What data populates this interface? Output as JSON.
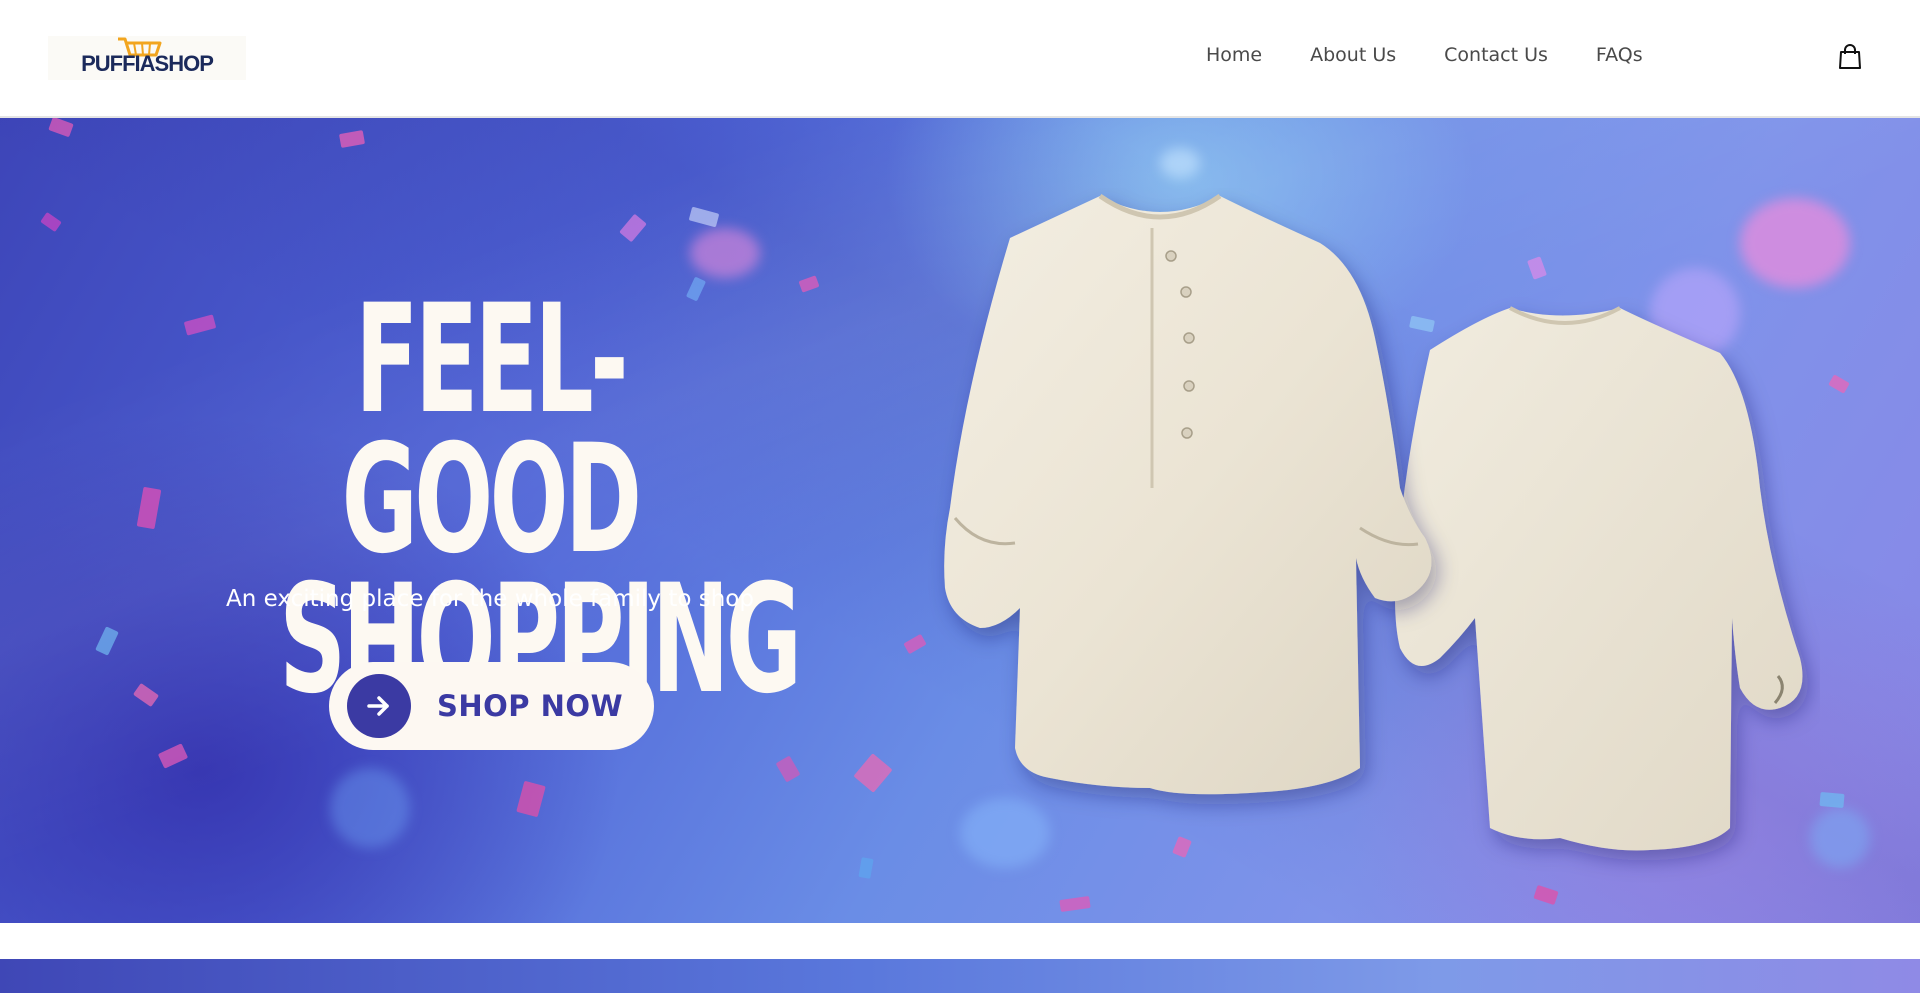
{
  "header": {
    "logo_text": "PUFFIASHOP",
    "logo_icon": "shopping-cart-icon",
    "nav": [
      {
        "label": "Home"
      },
      {
        "label": "About Us"
      },
      {
        "label": "Contact Us"
      },
      {
        "label": "FAQs"
      }
    ],
    "cart_icon": "shopping-bag-icon"
  },
  "hero": {
    "headline_line1": "FEEL-GOOD",
    "headline_line2": "SHOPPING",
    "subtitle": "An exciting place for the whole family to shop",
    "cta_label": "SHOP NOW",
    "cta_icon": "arrow-right-icon",
    "image": "two beige linen shirts"
  },
  "colors": {
    "brand_navy": "#1b2a5b",
    "brand_orange": "#f2a51f",
    "cta_purple": "#3b3aa3",
    "hero_text": "#fdf9f2"
  }
}
